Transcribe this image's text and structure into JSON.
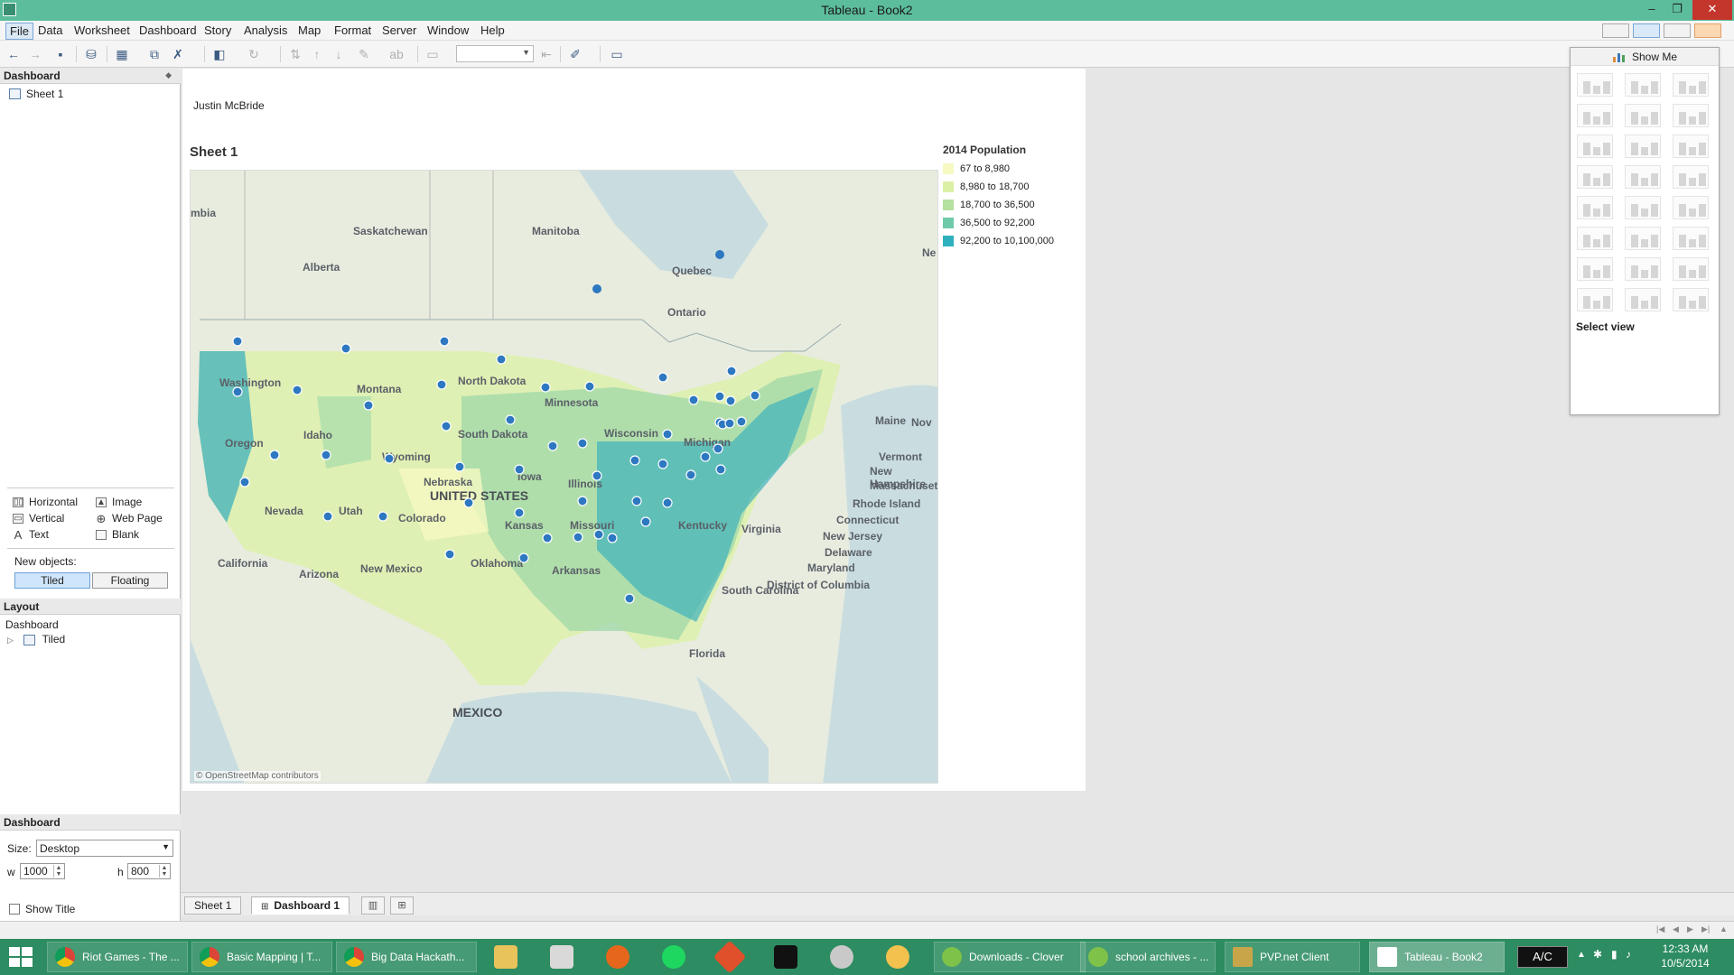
{
  "window": {
    "title": "Tableau - Book2"
  },
  "menu": [
    "File",
    "Data",
    "Worksheet",
    "Dashboard",
    "Story",
    "Analysis",
    "Map",
    "Format",
    "Server",
    "Window",
    "Help"
  ],
  "left_pane": {
    "dashboard_header": "Dashboard",
    "sheets": [
      "Sheet 1"
    ],
    "objects": [
      {
        "label": "Horizontal",
        "icon": "horizontal-container-icon"
      },
      {
        "label": "Image",
        "icon": "image-icon"
      },
      {
        "label": "Vertical",
        "icon": "vertical-container-icon"
      },
      {
        "label": "Web Page",
        "icon": "globe-icon"
      },
      {
        "label": "Text",
        "icon": "text-icon"
      },
      {
        "label": "Blank",
        "icon": "blank-icon"
      }
    ],
    "new_objects_label": "New objects:",
    "tiled_label": "Tiled",
    "floating_label": "Floating",
    "layout_header": "Layout",
    "layout_root": "Dashboard",
    "layout_child": "Tiled",
    "size_header": "Dashboard",
    "size_label": "Size:",
    "size_value": "Desktop",
    "w_label": "w",
    "w_value": "1000",
    "h_label": "h",
    "h_value": "800",
    "show_title_label": "Show Title"
  },
  "dashboard": {
    "author": "Justin McBride",
    "sheet_title": "Sheet 1",
    "map_credit": "© OpenStreetMap contributors",
    "map_labels": {
      "saskatchewan": "Saskatchewan",
      "manitoba": "Manitoba",
      "alberta": "Alberta",
      "ontario": "Ontario",
      "quebec": "Quebec",
      "united_states": "UNITED STATES",
      "mexico": "MEXICO",
      "vermont": "Vermont",
      "new_hampshire": "New Hampshire",
      "massachusetts": "Massachusetts",
      "rhode_island": "Rhode Island",
      "connecticut": "Connecticut",
      "new_jersey": "New Jersey",
      "delaware": "Delaware",
      "maryland": "Maryland",
      "district_of_columbia": "District of Columbia",
      "north_dakota": "North Dakota",
      "south_dakota": "South Dakota",
      "montana": "Montana",
      "wyoming": "Wyoming",
      "nebraska": "Nebraska",
      "colorado": "Colorado",
      "kansas": "Kansas",
      "oklahoma": "Oklahoma",
      "new_mexico": "New Mexico",
      "arizona": "Arizona",
      "california": "California",
      "nevada": "Nevada",
      "utah": "Utah",
      "idaho": "Idaho",
      "oregon": "Oregon",
      "washington": "Washington",
      "minnesota": "Minnesota",
      "wisconsin": "Wisconsin",
      "michigan": "Michigan",
      "iowa": "Iowa",
      "illinois": "Illinois",
      "missouri": "Missouri",
      "arkansas": "Arkansas",
      "kentucky": "Kentucky",
      "virginia": "Virginia",
      "south_carolina": "South Carolina",
      "florida": "Florida",
      "maine": "Maine",
      "nova": "Nov",
      "ne": "Ne",
      "mbia": "mbia"
    },
    "legend": {
      "title": "2014 Population",
      "items": [
        {
          "label": "67 to 8,980",
          "color": "#f6f9c2"
        },
        {
          "label": "8,980 to 18,700",
          "color": "#dbf0a6"
        },
        {
          "label": "18,700 to 36,500",
          "color": "#b4e0a0"
        },
        {
          "label": "36,500 to 92,200",
          "color": "#6fcaaa"
        },
        {
          "label": "92,200 to 10,100,000",
          "color": "#2fb0bf"
        }
      ]
    },
    "point_color": "#2d78c0"
  },
  "show_me": {
    "title": "Show Me",
    "select_view": "Select view"
  },
  "sheet_tabs": [
    "Sheet 1",
    "Dashboard 1"
  ],
  "taskbar": {
    "tasks": [
      "Riot Games - The ...",
      "Basic Mapping | T...",
      "Big Data Hackath...",
      "Downloads - Clover",
      "school archives - ...",
      "PVP.net Client",
      "Tableau - Book2"
    ],
    "ac_label": "A/C",
    "time": "12:33 AM",
    "date": "10/5/2014"
  }
}
